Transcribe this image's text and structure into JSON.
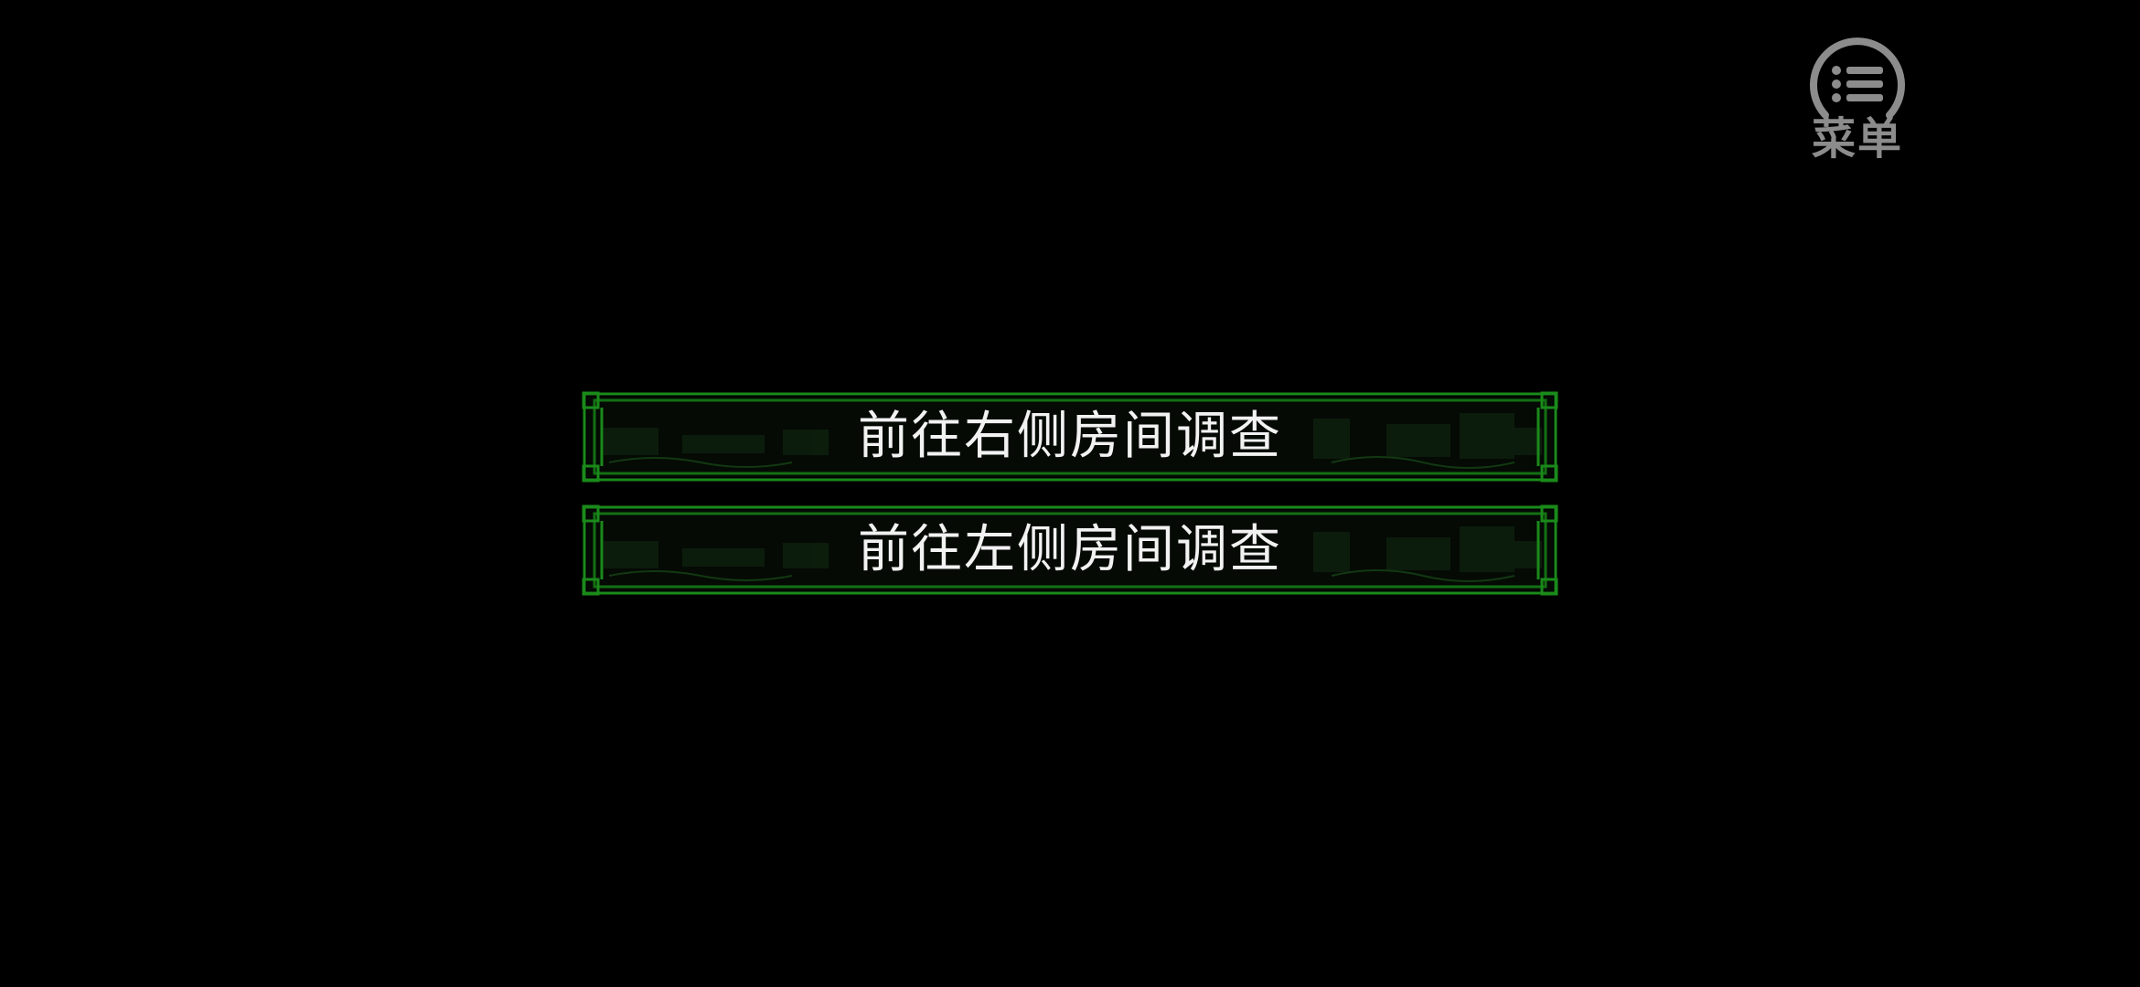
{
  "menu": {
    "label": "菜单",
    "icon": "list-menu-icon"
  },
  "choices": [
    {
      "label": "前往右侧房间调查"
    },
    {
      "label": "前往左侧房间调查"
    }
  ],
  "colors": {
    "background": "#000000",
    "frame_green": "#1a8a1a",
    "frame_dark_green": "#0c3d0c",
    "choice_text": "#f2f2f2",
    "menu_gray": "#8c8c8c"
  }
}
